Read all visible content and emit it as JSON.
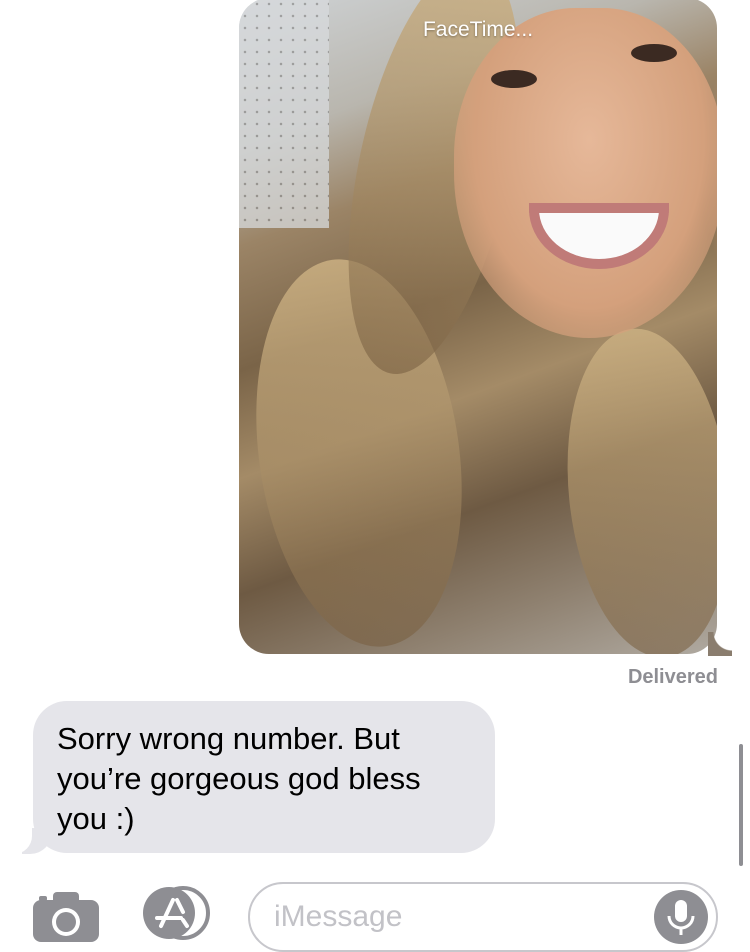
{
  "sent_message": {
    "image_caption": "FaceTime...",
    "status": "Delivered"
  },
  "received_message": {
    "text": "Sorry wrong number. But you’re gorgeous god bless you :)"
  },
  "compose_bar": {
    "placeholder": "iMessage",
    "camera_icon": "camera-icon",
    "appstore_icon": "app-store-icon",
    "mic_icon": "microphone-icon"
  },
  "colors": {
    "received_bubble": "#e5e5ea",
    "status_text": "#8e8e93",
    "placeholder_text": "#c2c2c7"
  }
}
